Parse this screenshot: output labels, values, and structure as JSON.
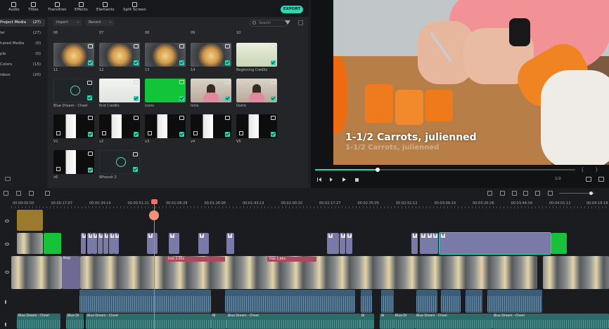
{
  "toolbar": {
    "items": [
      {
        "label": "Audio",
        "icon": "music-note-icon"
      },
      {
        "label": "Titles",
        "icon": "text-icon"
      },
      {
        "label": "Transition",
        "icon": "transition-icon"
      },
      {
        "label": "Effects",
        "icon": "effects-icon"
      },
      {
        "label": "Elements",
        "icon": "elements-icon"
      },
      {
        "label": "Split Screen",
        "icon": "split-screen-icon"
      }
    ],
    "export_label": "EXPORT"
  },
  "sidebar": {
    "items": [
      {
        "name": "Project Media",
        "count": "(27)",
        "selected": true
      },
      {
        "name": "ler",
        "count": "(27)"
      },
      {
        "name": "hared Media",
        "count": "(0)"
      },
      {
        "name": "ple",
        "count": "(0)"
      },
      {
        "name": "Colors",
        "count": "(15)"
      },
      {
        "name": "ideos",
        "count": "(20)"
      }
    ]
  },
  "media": {
    "import_label": "Import",
    "record_label": "Record",
    "search_placeholder": "Search",
    "top_row_labels": [
      "06",
      "07",
      "08",
      "09",
      "10"
    ],
    "items": [
      {
        "label": "11",
        "kind": "food"
      },
      {
        "label": "12",
        "kind": "food"
      },
      {
        "label": "13",
        "kind": "food"
      },
      {
        "label": "14",
        "kind": "food"
      },
      {
        "label": "Beginning Credits",
        "kind": "paper"
      },
      {
        "label": "Blue Dream - Cheel",
        "kind": "music"
      },
      {
        "label": "End Credits",
        "kind": "credits"
      },
      {
        "label": "icons",
        "kind": "green"
      },
      {
        "label": "Intro",
        "kind": "intro"
      },
      {
        "label": "Outro",
        "kind": "intro"
      },
      {
        "label": "V1",
        "kind": "cloth"
      },
      {
        "label": "v2",
        "kind": "cloth"
      },
      {
        "label": "v3",
        "kind": "cloth"
      },
      {
        "label": "v4",
        "kind": "cloth"
      },
      {
        "label": "V5",
        "kind": "cloth"
      },
      {
        "label": "v6",
        "kind": "cloth"
      },
      {
        "label": "Whoosh 2",
        "kind": "music"
      }
    ]
  },
  "preview": {
    "caption": "1-1/2 Carrots, julienned",
    "caption_shadow": "1-1/2 Carrots, julienned",
    "progress": 0.24,
    "page_indicator": "1/2"
  },
  "timeline": {
    "timecodes": [
      "00:00:00:00",
      "00:00:17:07",
      "00:00:34:14",
      "00:00:51:21",
      "00:01:08:28",
      "00:01:26:06",
      "00:01:43:13",
      "00:02:00:20",
      "00:02:17:27",
      "00:02:35:05",
      "00:02:52:12",
      "00:03:09:19",
      "00:03:26:26",
      "00:03:44:04",
      "00:04:01:11",
      "00:04:18:18"
    ],
    "speed_tags": [
      "Fast 2.00x",
      "Fast 1.80x"
    ],
    "video_clip_label": "Begi",
    "music_label": "Blue Dream - Cheel",
    "music_label_short": "Blue Dr",
    "music_label_min": "Bl"
  }
}
